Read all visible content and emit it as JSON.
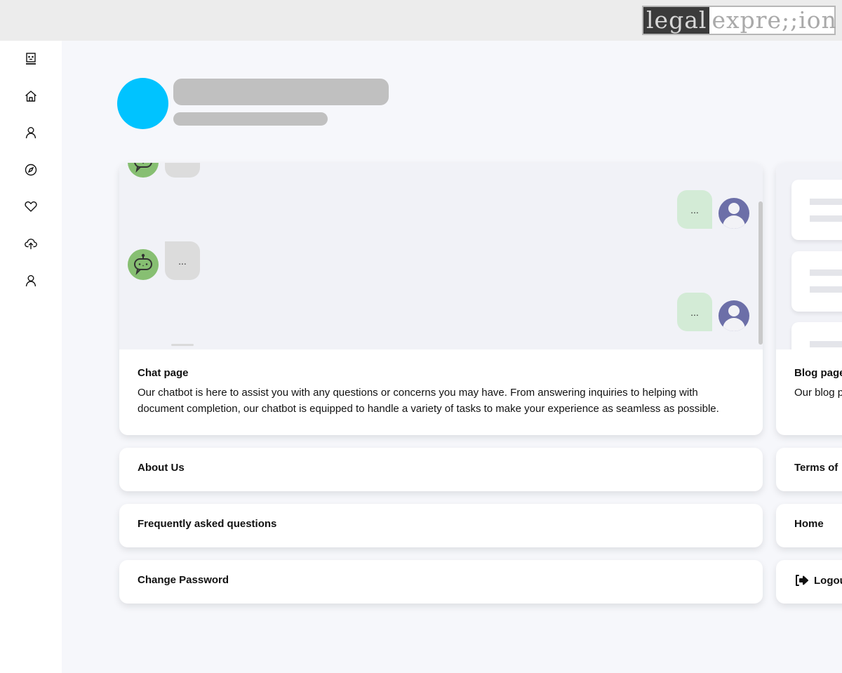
{
  "header": {
    "logo": {
      "part1": "legal",
      "part2": "expre;;ion"
    }
  },
  "sidebar": {
    "items": [
      {
        "name": "bot",
        "icon": "robot-face-icon"
      },
      {
        "name": "home",
        "icon": "home-icon"
      },
      {
        "name": "profile",
        "icon": "user-icon"
      },
      {
        "name": "explore",
        "icon": "compass-icon"
      },
      {
        "name": "favorites",
        "icon": "heart-icon"
      },
      {
        "name": "upload",
        "icon": "cloud-upload-icon"
      },
      {
        "name": "account",
        "icon": "user-icon"
      }
    ]
  },
  "profile": {
    "name": "",
    "subtitle": "",
    "avatar_color": "#00c3ff"
  },
  "cards": {
    "chat": {
      "title": "Chat page",
      "description": "Our chatbot is here to assist you with any questions or concerns you may have. From answering inquiries to helping with document completion, our chatbot is equipped to handle a variety of tasks to make your experience as seamless as possible.",
      "messages": [
        {
          "from": "bot",
          "text": ""
        },
        {
          "from": "user",
          "text": "..."
        },
        {
          "from": "bot",
          "text": "..."
        },
        {
          "from": "user",
          "text": "..."
        }
      ]
    },
    "blog": {
      "title": "Blog page",
      "description": "Our blog p... to-date wit..."
    },
    "links_left": [
      {
        "label": "About Us"
      },
      {
        "label": "Frequently asked questions"
      },
      {
        "label": "Change Password"
      }
    ],
    "links_right": [
      {
        "label": "Terms of"
      },
      {
        "label": "Home"
      },
      {
        "label": "Logout",
        "icon": "logout-icon"
      }
    ]
  },
  "colors": {
    "bot_avatar": "#87bf72",
    "user_avatar": "#6c6fa8",
    "user_bubble": "#d3ebd6",
    "bot_bubble": "#dcdcdc",
    "page_bg": "#f6f7fb"
  }
}
